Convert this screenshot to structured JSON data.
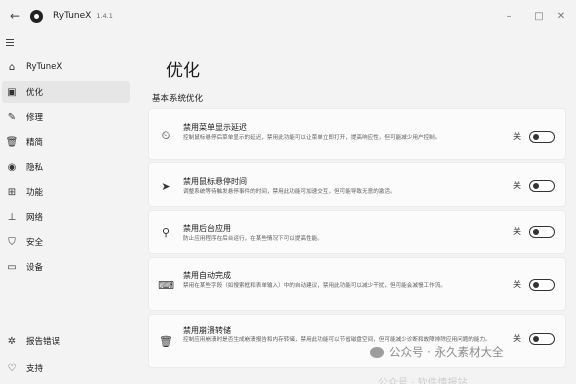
{
  "titlebar": {
    "app_name": "RyTuneX",
    "version": "1.4.1",
    "back_glyph": "←",
    "minimize_glyph": "–",
    "maximize_glyph": "□",
    "close_glyph": "✕"
  },
  "sidebar": {
    "items": [
      {
        "label": "RyTuneX",
        "icon": "home-icon",
        "glyph": "⌂"
      },
      {
        "label": "优化",
        "icon": "optimize-icon",
        "glyph": "▣"
      },
      {
        "label": "修理",
        "icon": "repair-icon",
        "glyph": "✎"
      },
      {
        "label": "精简",
        "icon": "debloat-icon",
        "glyph": "🗑"
      },
      {
        "label": "隐私",
        "icon": "privacy-icon",
        "glyph": "◉"
      },
      {
        "label": "功能",
        "icon": "features-icon",
        "glyph": "⊞"
      },
      {
        "label": "网络",
        "icon": "network-icon",
        "glyph": "⊥"
      },
      {
        "label": "安全",
        "icon": "shield-icon",
        "glyph": "⛉"
      },
      {
        "label": "设备",
        "icon": "device-icon",
        "glyph": "▭"
      }
    ],
    "bottom_items": [
      {
        "label": "报告错误",
        "icon": "bug-icon",
        "glyph": "✲"
      },
      {
        "label": "支持",
        "icon": "support-icon",
        "glyph": "♡"
      }
    ],
    "active_index": 1
  },
  "main": {
    "page_title": "优化",
    "section_title": "基本系统优化",
    "cards": [
      {
        "title": "禁用菜单显示延迟",
        "description": "控制鼠标悬停后菜单显示的延迟，禁用此功能可以让菜单立即打开，提高响应性，但可能减少用户控制。",
        "state": "关",
        "icon": "menu-delay-icon",
        "glyph": "⏲"
      },
      {
        "title": "禁用鼠标悬停时间",
        "description": "调整系统等待触发悬停事件的时间，禁用此功能可加速交互，但可能导致无意的激活。",
        "state": "关",
        "icon": "mouse-pointer-icon",
        "glyph": "➤"
      },
      {
        "title": "禁用后台应用",
        "description": "防止应用程序在后台运行，在某些情况下可以提高性能。",
        "state": "关",
        "icon": "background-apps-icon",
        "glyph": "⚲"
      },
      {
        "title": "禁用自动完成",
        "description": "禁用在某些字段（如搜索框和表单输入）中的自动建议，禁用此功能可以减少干扰，但可能会减慢工作流。",
        "state": "关",
        "icon": "keyboard-icon",
        "glyph": "⌨"
      },
      {
        "title": "禁用崩溃转储",
        "description": "控制应用崩溃时是否生成崩溃报告和内存转储，禁用此功能可以节省磁盘空间，但可能减少诊断和故障排除应用问题的能力。",
        "state": "关",
        "icon": "trash-icon",
        "glyph": "🗑"
      }
    ]
  },
  "watermark": {
    "text": "公众号 · 永久素材大全",
    "text2": "公众号 · 软件情报站"
  }
}
